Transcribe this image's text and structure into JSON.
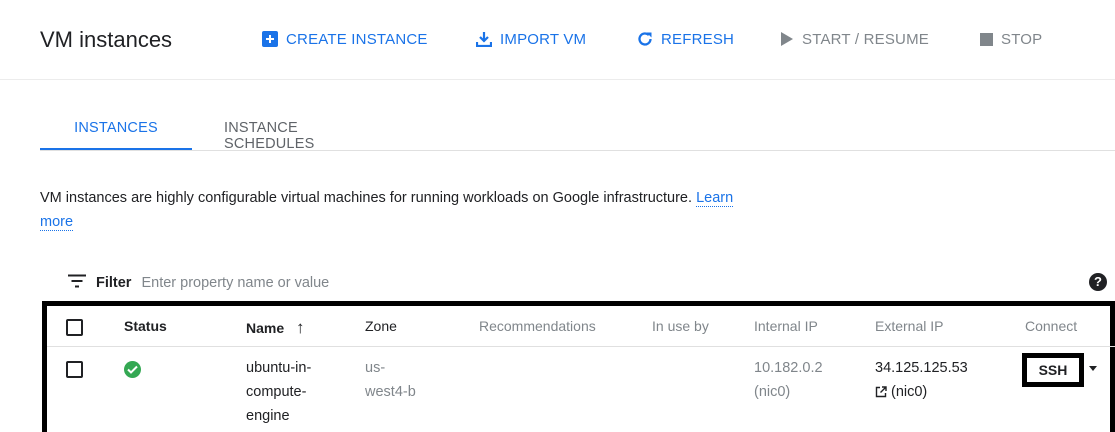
{
  "header": {
    "title": "VM instances",
    "actions": {
      "create": "CREATE INSTANCE",
      "import": "IMPORT VM",
      "refresh": "REFRESH",
      "start": "START / RESUME",
      "stop": "STOP"
    }
  },
  "tabs": [
    {
      "label": "INSTANCES",
      "active": true
    },
    {
      "label": "INSTANCE SCHEDULES",
      "active": false
    }
  ],
  "description": {
    "text": "VM instances are highly configurable virtual machines for running workloads on Google infrastructure.",
    "link": "Learn more"
  },
  "filter": {
    "label": "Filter",
    "placeholder": "Enter property name or value"
  },
  "table": {
    "columns": [
      "Status",
      "Name",
      "Zone",
      "Recommendations",
      "In use by",
      "Internal IP",
      "External IP",
      "Connect"
    ],
    "sort_indicator": "↑",
    "rows": [
      {
        "status": "running",
        "name": [
          "ubuntu-in-",
          "compute-",
          "engine"
        ],
        "zone": [
          "us-",
          "west4-b"
        ],
        "recommendations": "",
        "in_use_by": "",
        "internal_ip": [
          "10.182.0.2",
          "(nic0)"
        ],
        "external_ip": [
          "34.125.125.53",
          "(nic0)"
        ],
        "connect": "SSH"
      }
    ]
  },
  "colors": {
    "accent": "#1a73e8",
    "disabled": "#80868b",
    "status_ok": "#34a853"
  },
  "icons": {
    "create": "add-box-icon",
    "import": "import-icon",
    "refresh": "refresh-icon",
    "start": "play-icon",
    "stop": "stop-icon",
    "filter": "filter-icon",
    "help": "help-icon",
    "status": "check-circle-icon",
    "external": "external-link-icon",
    "ssh_menu": "caret-down-icon"
  }
}
